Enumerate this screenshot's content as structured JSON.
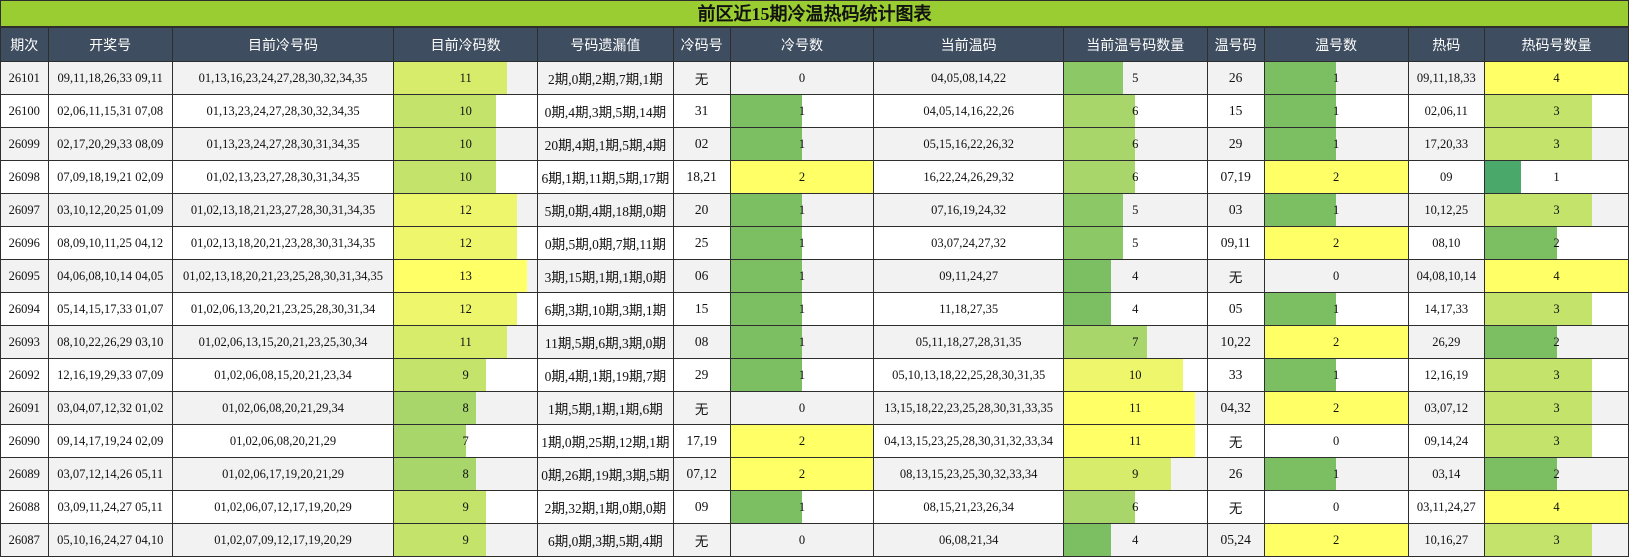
{
  "title": "前区近15期冷温热码统计图表",
  "headers": [
    "期次",
    "开奖号",
    "目前冷号码",
    "目前冷码数",
    "号码遗漏值",
    "冷码号",
    "冷号数",
    "当前温码",
    "当前温号码数量",
    "温号码",
    "温号数",
    "热码",
    "热码号数量"
  ],
  "bar_max": {
    "cold_count": 14,
    "cold_num": 2,
    "warm_count": 12,
    "warm_num": 2,
    "hot_num": 4
  },
  "rows": [
    {
      "period": "26101",
      "draw": "09,11,18,26,33 09,11",
      "cold_list": "01,13,16,23,24,27,28,30,32,34,35",
      "cold_count": 11,
      "omit": "2期,0期,2期,7期,1期",
      "cold_nums": "无",
      "cold_num": 0,
      "warm_list": "04,05,08,14,22",
      "warm_count": 5,
      "warm_nums": "26",
      "warm_num": 1,
      "hot_list": "09,11,18,33",
      "hot_num": 4
    },
    {
      "period": "26100",
      "draw": "02,06,11,15,31 07,08",
      "cold_list": "01,13,23,24,27,28,30,32,34,35",
      "cold_count": 10,
      "omit": "0期,4期,3期,5期,14期",
      "cold_nums": "31",
      "cold_num": 1,
      "warm_list": "04,05,14,16,22,26",
      "warm_count": 6,
      "warm_nums": "15",
      "warm_num": 1,
      "hot_list": "02,06,11",
      "hot_num": 3
    },
    {
      "period": "26099",
      "draw": "02,17,20,29,33 08,09",
      "cold_list": "01,13,23,24,27,28,30,31,34,35",
      "cold_count": 10,
      "omit": "20期,4期,1期,5期,4期",
      "cold_nums": "02",
      "cold_num": 1,
      "warm_list": "05,15,16,22,26,32",
      "warm_count": 6,
      "warm_nums": "29",
      "warm_num": 1,
      "hot_list": "17,20,33",
      "hot_num": 3
    },
    {
      "period": "26098",
      "draw": "07,09,18,19,21 02,09",
      "cold_list": "01,02,13,23,27,28,30,31,34,35",
      "cold_count": 10,
      "omit": "6期,1期,11期,5期,17期",
      "cold_nums": "18,21",
      "cold_num": 2,
      "warm_list": "16,22,24,26,29,32",
      "warm_count": 6,
      "warm_nums": "07,19",
      "warm_num": 2,
      "hot_list": "09",
      "hot_num": 1
    },
    {
      "period": "26097",
      "draw": "03,10,12,20,25 01,09",
      "cold_list": "01,02,13,18,21,23,27,28,30,31,34,35",
      "cold_count": 12,
      "omit": "5期,0期,4期,18期,0期",
      "cold_nums": "20",
      "cold_num": 1,
      "warm_list": "07,16,19,24,32",
      "warm_count": 5,
      "warm_nums": "03",
      "warm_num": 1,
      "hot_list": "10,12,25",
      "hot_num": 3
    },
    {
      "period": "26096",
      "draw": "08,09,10,11,25 04,12",
      "cold_list": "01,02,13,18,20,21,23,28,30,31,34,35",
      "cold_count": 12,
      "omit": "0期,5期,0期,7期,11期",
      "cold_nums": "25",
      "cold_num": 1,
      "warm_list": "03,07,24,27,32",
      "warm_count": 5,
      "warm_nums": "09,11",
      "warm_num": 2,
      "hot_list": "08,10",
      "hot_num": 2
    },
    {
      "period": "26095",
      "draw": "04,06,08,10,14 04,05",
      "cold_list": "01,02,13,18,20,21,23,25,28,30,31,34,35",
      "cold_count": 13,
      "omit": "3期,15期,1期,1期,0期",
      "cold_nums": "06",
      "cold_num": 1,
      "warm_list": "09,11,24,27",
      "warm_count": 4,
      "warm_nums": "无",
      "warm_num": 0,
      "hot_list": "04,08,10,14",
      "hot_num": 4
    },
    {
      "period": "26094",
      "draw": "05,14,15,17,33 01,07",
      "cold_list": "01,02,06,13,20,21,23,25,28,30,31,34",
      "cold_count": 12,
      "omit": "6期,3期,10期,3期,1期",
      "cold_nums": "15",
      "cold_num": 1,
      "warm_list": "11,18,27,35",
      "warm_count": 4,
      "warm_nums": "05",
      "warm_num": 1,
      "hot_list": "14,17,33",
      "hot_num": 3
    },
    {
      "period": "26093",
      "draw": "08,10,22,26,29 03,10",
      "cold_list": "01,02,06,13,15,20,21,23,25,30,34",
      "cold_count": 11,
      "omit": "11期,5期,6期,3期,0期",
      "cold_nums": "08",
      "cold_num": 1,
      "warm_list": "05,11,18,27,28,31,35",
      "warm_count": 7,
      "warm_nums": "10,22",
      "warm_num": 2,
      "hot_list": "26,29",
      "hot_num": 2
    },
    {
      "period": "26092",
      "draw": "12,16,19,29,33 07,09",
      "cold_list": "01,02,06,08,15,20,21,23,34",
      "cold_count": 9,
      "omit": "0期,4期,1期,19期,7期",
      "cold_nums": "29",
      "cold_num": 1,
      "warm_list": "05,10,13,18,22,25,28,30,31,35",
      "warm_count": 10,
      "warm_nums": "33",
      "warm_num": 1,
      "hot_list": "12,16,19",
      "hot_num": 3
    },
    {
      "period": "26091",
      "draw": "03,04,07,12,32 01,02",
      "cold_list": "01,02,06,08,20,21,29,34",
      "cold_count": 8,
      "omit": "1期,5期,1期,1期,6期",
      "cold_nums": "无",
      "cold_num": 0,
      "warm_list": "13,15,18,22,23,25,28,30,31,33,35",
      "warm_count": 11,
      "warm_nums": "04,32",
      "warm_num": 2,
      "hot_list": "03,07,12",
      "hot_num": 3
    },
    {
      "period": "26090",
      "draw": "09,14,17,19,24 02,09",
      "cold_list": "01,02,06,08,20,21,29",
      "cold_count": 7,
      "omit": "1期,0期,25期,12期,1期",
      "cold_nums": "17,19",
      "cold_num": 2,
      "warm_list": "04,13,15,23,25,28,30,31,32,33,34",
      "warm_count": 11,
      "warm_nums": "无",
      "warm_num": 0,
      "hot_list": "09,14,24",
      "hot_num": 3
    },
    {
      "period": "26089",
      "draw": "03,07,12,14,26 05,11",
      "cold_list": "01,02,06,17,19,20,21,29",
      "cold_count": 8,
      "omit": "0期,26期,19期,3期,5期",
      "cold_nums": "07,12",
      "cold_num": 2,
      "warm_list": "08,13,15,23,25,30,32,33,34",
      "warm_count": 9,
      "warm_nums": "26",
      "warm_num": 1,
      "hot_list": "03,14",
      "hot_num": 2
    },
    {
      "period": "26088",
      "draw": "03,09,11,24,27 05,11",
      "cold_list": "01,02,06,07,12,17,19,20,29",
      "cold_count": 9,
      "omit": "2期,32期,1期,0期,0期",
      "cold_nums": "09",
      "cold_num": 1,
      "warm_list": "08,15,21,23,26,34",
      "warm_count": 6,
      "warm_nums": "无",
      "warm_num": 0,
      "hot_list": "03,11,24,27",
      "hot_num": 4
    },
    {
      "period": "26087",
      "draw": "05,10,16,24,27 04,10",
      "cold_list": "01,02,07,09,12,17,19,20,29",
      "cold_count": 9,
      "omit": "6期,0期,3期,5期,4期",
      "cold_nums": "无",
      "cold_num": 0,
      "warm_list": "06,08,21,34",
      "warm_count": 4,
      "warm_nums": "05,24",
      "warm_num": 2,
      "hot_list": "10,16,27",
      "hot_num": 3
    }
  ]
}
